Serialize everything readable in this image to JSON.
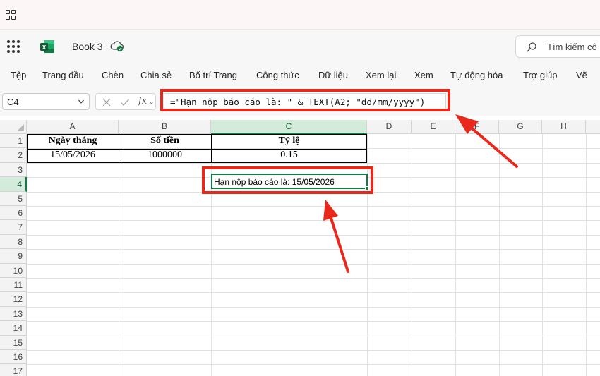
{
  "app": {
    "book_title": "Book 3",
    "search_placeholder": "Tìm kiếm cô"
  },
  "menu": {
    "items": [
      "Tệp",
      "Trang đầu",
      "Chèn",
      "Chia sẻ",
      "Bố trí Trang",
      "Công thức",
      "Dữ liệu",
      "Xem lại",
      "Xem",
      "Tự động hóa",
      "Trợ giúp",
      "Vẽ"
    ]
  },
  "formula_bar": {
    "name_box": "C4",
    "fx_label": "fx",
    "formula": "=\"Hạn nộp báo cáo là: \" & TEXT(A2; \"dd/mm/yyyy\")"
  },
  "sheet": {
    "columns": [
      "A",
      "B",
      "C",
      "D",
      "E",
      "F",
      "G",
      "H"
    ],
    "selected_column": "C",
    "rows": [
      "1",
      "2",
      "3",
      "4",
      "5",
      "6",
      "7",
      "8",
      "9",
      "10",
      "11",
      "12",
      "13",
      "14",
      "15",
      "16",
      "17"
    ],
    "selected_row": "4",
    "table": {
      "headers": [
        "Ngày tháng",
        "Số tiền",
        "Tỷ lệ"
      ],
      "row2": [
        "15/05/2026",
        "1000000",
        "0.15"
      ]
    },
    "active_cell_value": "Hạn nộp báo cáo là: 15/05/2026"
  },
  "colors": {
    "accent_green": "#107c41",
    "annotation_red": "#e8281a"
  }
}
